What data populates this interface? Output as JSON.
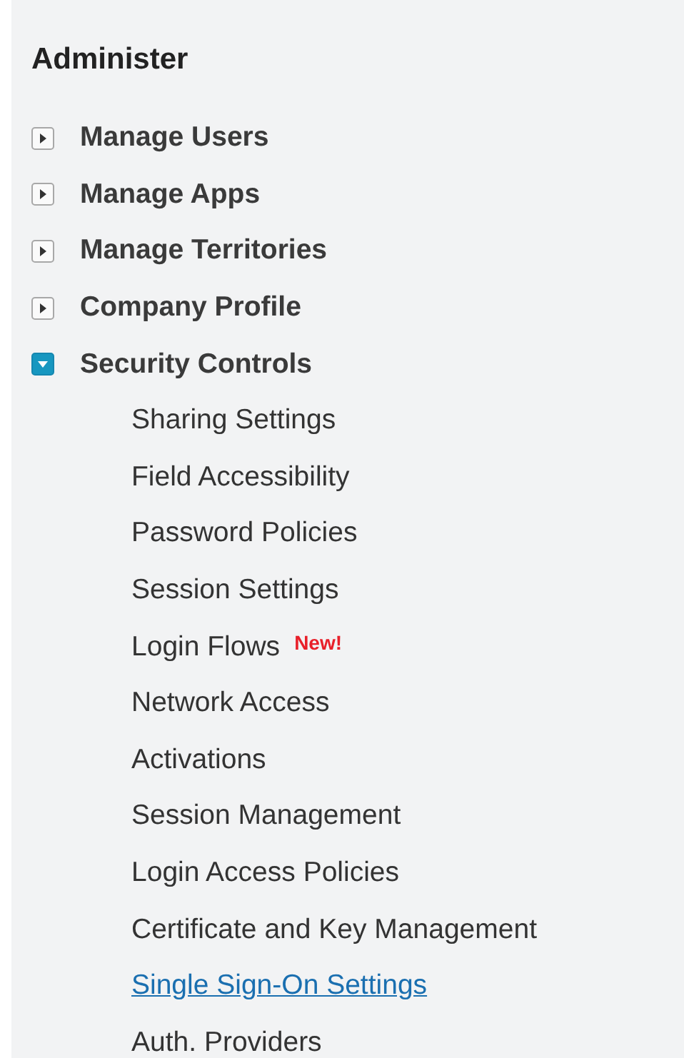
{
  "title": "Administer",
  "sections": [
    {
      "label": "Manage Users",
      "expanded": false
    },
    {
      "label": "Manage Apps",
      "expanded": false
    },
    {
      "label": "Manage Territories",
      "expanded": false
    },
    {
      "label": "Company Profile",
      "expanded": false
    },
    {
      "label": "Security Controls",
      "expanded": true,
      "children": [
        {
          "label": "Sharing Settings",
          "selected": false
        },
        {
          "label": "Field Accessibility",
          "selected": false
        },
        {
          "label": "Password Policies",
          "selected": false
        },
        {
          "label": "Session Settings",
          "selected": false
        },
        {
          "label": "Login Flows",
          "selected": false,
          "badge": "New!"
        },
        {
          "label": "Network Access",
          "selected": false
        },
        {
          "label": "Activations",
          "selected": false
        },
        {
          "label": "Session Management",
          "selected": false
        },
        {
          "label": "Login Access Policies",
          "selected": false
        },
        {
          "label": "Certificate and Key Management",
          "selected": false
        },
        {
          "label": "Single Sign-On Settings",
          "selected": true
        },
        {
          "label": "Auth. Providers",
          "selected": false
        }
      ]
    }
  ]
}
